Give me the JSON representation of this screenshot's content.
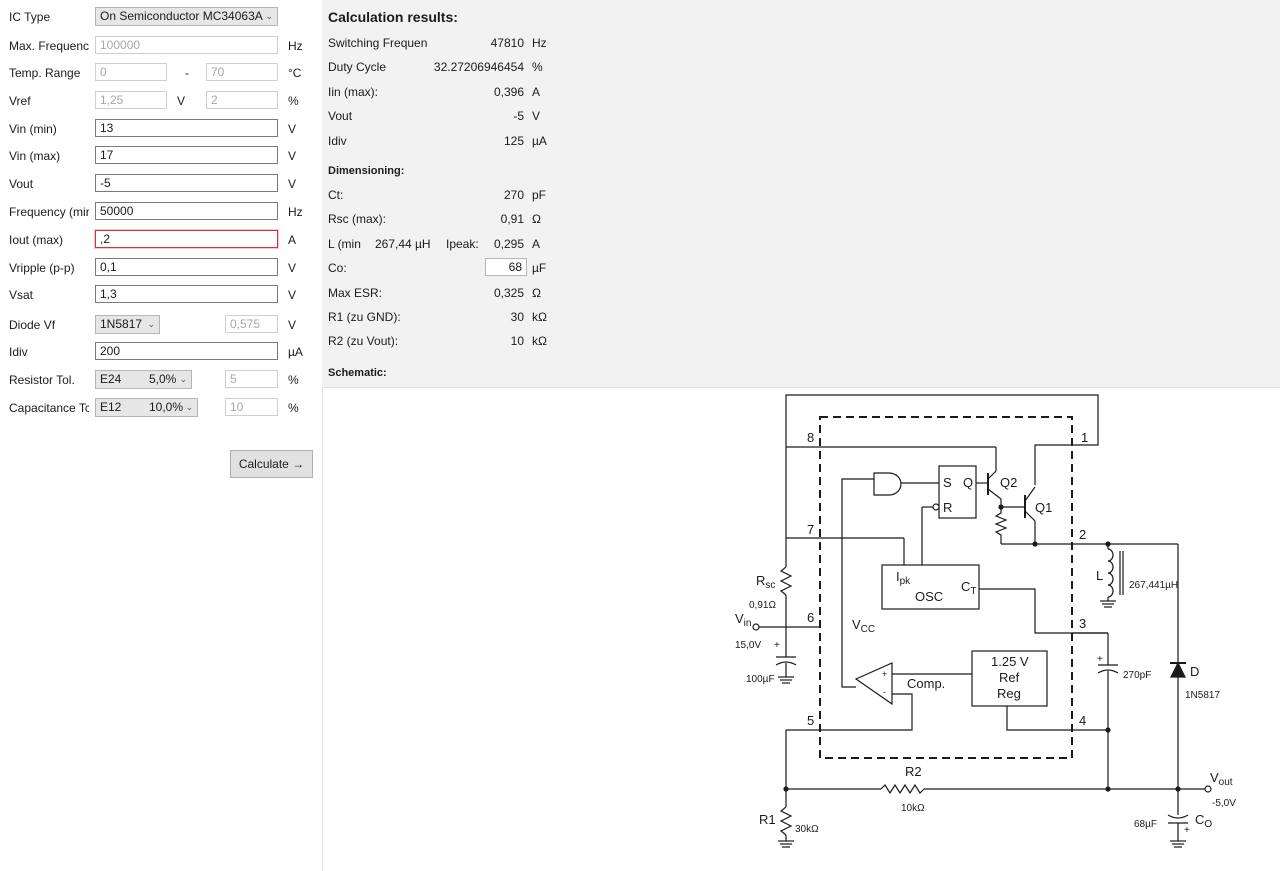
{
  "inputs": {
    "ic_type": {
      "label": "IC Type",
      "value": "On Semiconductor MC34063A"
    },
    "max_freq": {
      "label": "Max. Frequenc",
      "value": "100000",
      "unit": "Hz"
    },
    "temp_range": {
      "label": "Temp. Range",
      "min": "0",
      "sep": "-",
      "max": "70",
      "unit": "°C"
    },
    "vref": {
      "label": "Vref",
      "value": "1,25",
      "unit1": "V",
      "tol": "2",
      "unit2": "%"
    },
    "vin_min": {
      "label": "Vin (min)",
      "value": "13",
      "unit": "V"
    },
    "vin_max": {
      "label": "Vin (max)",
      "value": "17",
      "unit": "V"
    },
    "vout": {
      "label": "Vout",
      "value": "-5",
      "unit": "V"
    },
    "frequency": {
      "label": "Frequency (mir",
      "value": "50000",
      "unit": "Hz"
    },
    "iout_max": {
      "label": "Iout (max)",
      "value": ",2",
      "unit": "A"
    },
    "vripple": {
      "label": "Vripple (p-p)",
      "value": "0,1",
      "unit": "V"
    },
    "vsat": {
      "label": "Vsat",
      "value": "1,3",
      "unit": "V"
    },
    "diode_vf": {
      "label": "Diode Vf",
      "combo": "1N5817",
      "value": "0,575",
      "unit": "V"
    },
    "idiv": {
      "label": "Idiv",
      "value": "200",
      "unit": "µA"
    },
    "resistor_tol": {
      "label": "Resistor Tol.",
      "series": "E24",
      "pct": "5,0%",
      "value": "5",
      "unit": "%"
    },
    "capacitance_tol": {
      "label": "Capacitance Tc",
      "series": "E12",
      "pct": "10,0%",
      "value": "10",
      "unit": "%"
    },
    "calculate_label": "Calculate →"
  },
  "results": {
    "title": "Calculation results:",
    "switching_freq": {
      "label": "Switching Frequenc",
      "value": "47810",
      "unit": "Hz"
    },
    "duty_cycle": {
      "label": "Duty Cycle",
      "value": "32.27206946454",
      "unit": "%"
    },
    "iin_max": {
      "label": "Iin (max):",
      "value": "0,396",
      "unit": "A"
    },
    "vout": {
      "label": "Vout",
      "value": "-5",
      "unit": "V"
    },
    "idiv": {
      "label": "Idiv",
      "value": "125",
      "unit": "µA"
    },
    "dimensioning": "Dimensioning:",
    "ct": {
      "label": "Ct:",
      "value": "270",
      "unit": "pF"
    },
    "rsc_max": {
      "label": "Rsc (max):",
      "value": "0,91",
      "unit": "Ω"
    },
    "l_min": {
      "label": "L (min",
      "value": "267,44",
      "unit": "µH",
      "ipeak_label": "Ipeak:",
      "ipeak_value": "0,295",
      "ipeak_unit": "A"
    },
    "co": {
      "label": "Co:",
      "value": "68",
      "unit": "µF"
    },
    "max_esr": {
      "label": "Max ESR:",
      "value": "0,325",
      "unit": "Ω"
    },
    "r1": {
      "label": "R1 (zu GND):",
      "value": "30",
      "unit": "kΩ"
    },
    "r2": {
      "label": "R2 (zu Vout):",
      "value": "10",
      "unit": "kΩ"
    },
    "schematic": "Schematic:"
  },
  "schematic": {
    "pin1": "1",
    "pin2": "2",
    "pin3": "3",
    "pin4": "4",
    "pin5": "5",
    "pin6": "6",
    "pin7": "7",
    "pin8": "8",
    "q1": "Q1",
    "q2": "Q2",
    "s": "S",
    "q": "Q",
    "r": "R",
    "ipk": "I",
    "ipk_sub": "pk",
    "osc": "OSC",
    "ct": "C",
    "ct_sub": "T",
    "vcc": "V",
    "vcc_sub": "CC",
    "comp": "Comp.",
    "ref1": "1.25 V",
    "ref2": "Ref",
    "ref3": "Reg",
    "rsc": "R",
    "rsc_sub": "sc",
    "rsc_val": "0,91Ω",
    "vin": "V",
    "vin_sub": "in",
    "vin_val": "15,0V",
    "cin_val": "100µF",
    "l": "L",
    "l_val": "267,441µH",
    "ct_val": "270pF",
    "d": "D",
    "d_val": "1N5817",
    "vout": "V",
    "vout_sub": "out",
    "vout_val": "-5,0V",
    "co": "C",
    "co_sub": "O",
    "co_val": "68µF",
    "r2": "R2",
    "r2_val": "10kΩ",
    "r1": "R1",
    "r1_val": "30kΩ",
    "plus": "+",
    "minus": "-"
  }
}
